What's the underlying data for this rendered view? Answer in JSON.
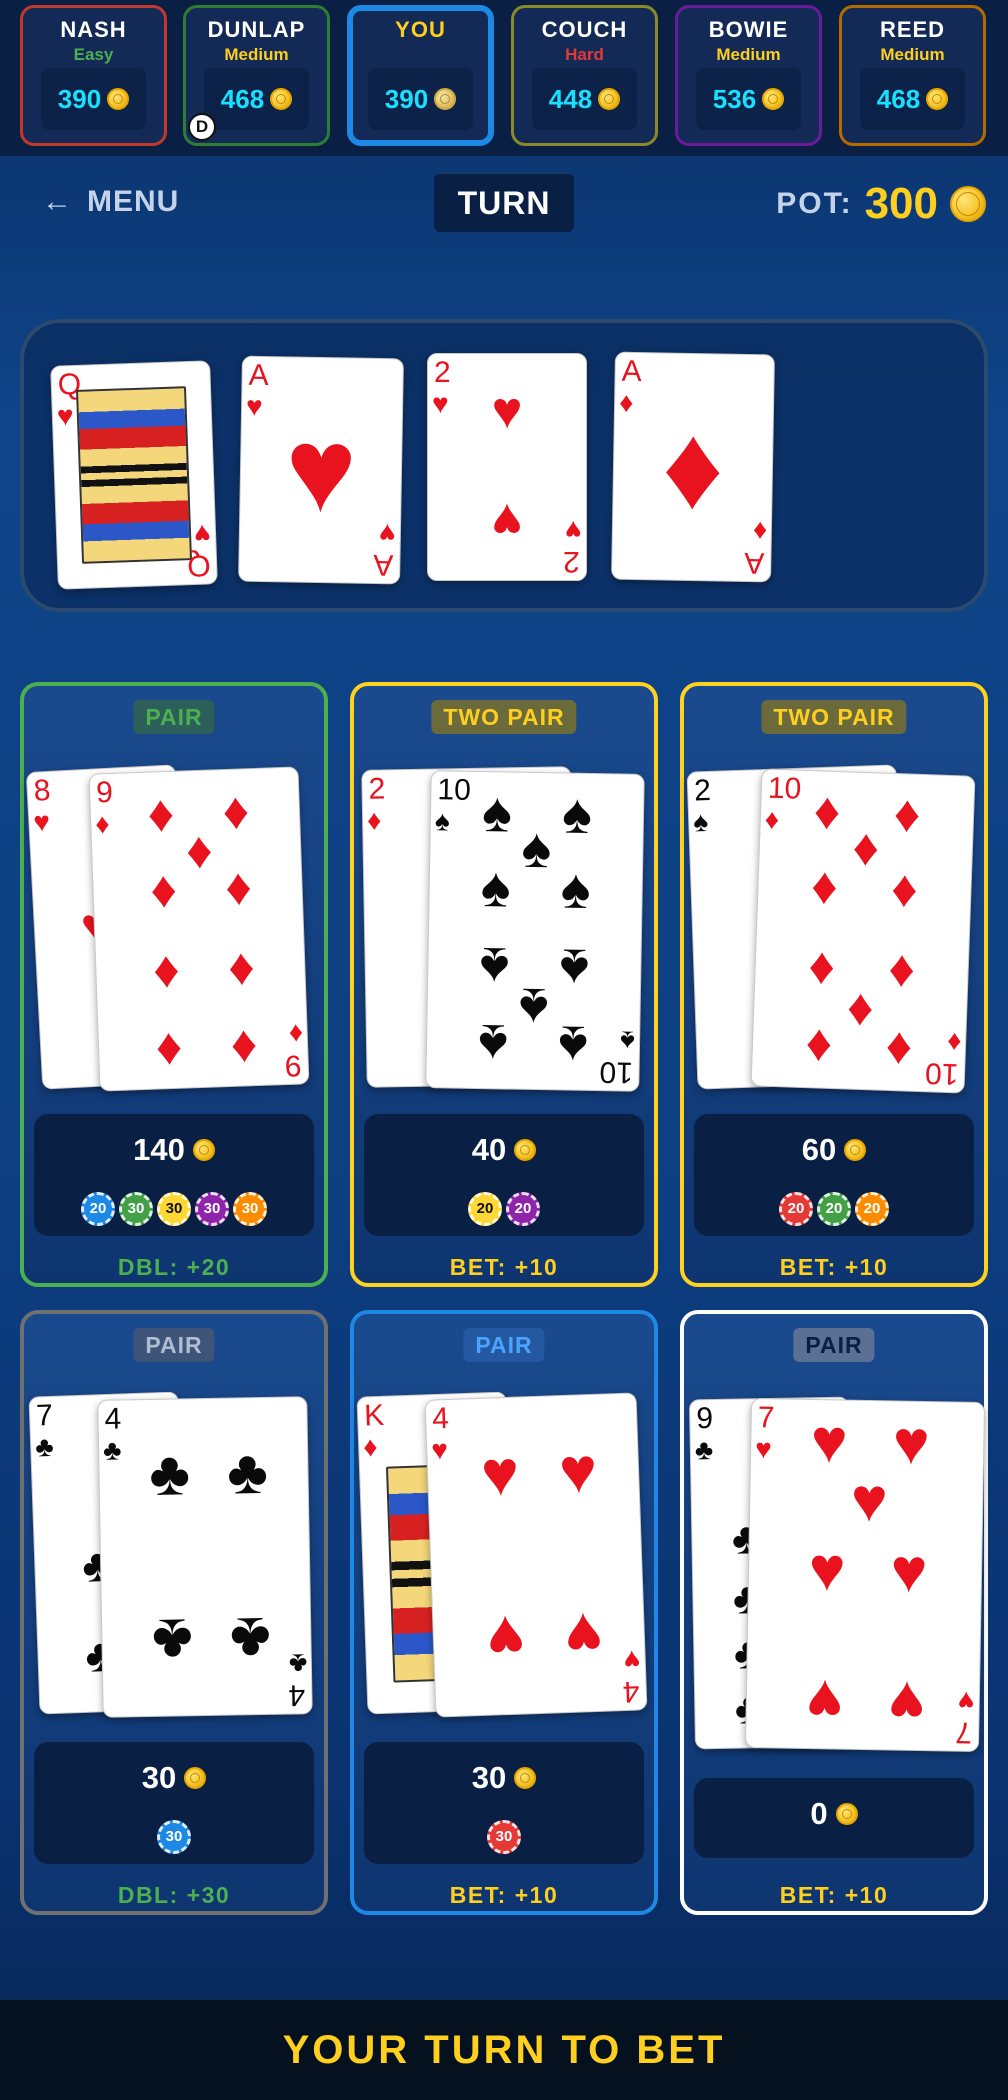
{
  "players": [
    {
      "name": "NASH",
      "difficulty": "Easy",
      "chips": "390",
      "difficulty_color": "#4caf50",
      "border": "#c0392b",
      "is_dealer": false
    },
    {
      "name": "DUNLAP",
      "difficulty": "Medium",
      "chips": "468",
      "difficulty_color": "#ffcf1f",
      "border": "#2e7d32",
      "is_dealer": true
    },
    {
      "name": "YOU",
      "difficulty": "",
      "chips": "390",
      "difficulty_color": "#ffcf1f",
      "border": "#1e88e5",
      "is_dealer": false
    },
    {
      "name": "COUCH",
      "difficulty": "Hard",
      "chips": "448",
      "difficulty_color": "#e53935",
      "border": "#8a8a2a",
      "is_dealer": false
    },
    {
      "name": "BOWIE",
      "difficulty": "Medium",
      "chips": "536",
      "difficulty_color": "#ffcf1f",
      "border": "#6a1b9a",
      "is_dealer": false
    },
    {
      "name": "REED",
      "difficulty": "Medium",
      "chips": "468",
      "difficulty_color": "#ffcf1f",
      "border": "#b36b00",
      "is_dealer": false
    }
  ],
  "dealer_marker": "D",
  "header": {
    "menu_label": "MENU",
    "round": "TURN",
    "pot_label": "POT:",
    "pot_value": "300"
  },
  "board_cards": [
    {
      "rank": "Q",
      "suit": "♥"
    },
    {
      "rank": "A",
      "suit": "♥"
    },
    {
      "rank": "2",
      "suit": "♥"
    },
    {
      "rank": "A",
      "suit": "♦"
    }
  ],
  "hands": [
    {
      "badge": "PAIR",
      "amount": "140",
      "action": "DBL: +20",
      "cards": [
        {
          "rank": "8",
          "suit": "♥"
        },
        {
          "rank": "9",
          "suit": "♦"
        }
      ],
      "chips": [
        {
          "v": "20",
          "c": "#1e88e5"
        },
        {
          "v": "30",
          "c": "#43a047"
        },
        {
          "v": "30",
          "c": "#fdd835"
        },
        {
          "v": "30",
          "c": "#8e24aa"
        },
        {
          "v": "30",
          "c": "#fb8c00"
        }
      ]
    },
    {
      "badge": "TWO PAIR",
      "amount": "40",
      "action": "BET: +10",
      "cards": [
        {
          "rank": "2",
          "suit": "♦"
        },
        {
          "rank": "10",
          "suit": "♠"
        }
      ],
      "chips": [
        {
          "v": "20",
          "c": "#fdd835"
        },
        {
          "v": "20",
          "c": "#8e24aa"
        }
      ]
    },
    {
      "badge": "TWO PAIR",
      "amount": "60",
      "action": "BET: +10",
      "cards": [
        {
          "rank": "2",
          "suit": "♠"
        },
        {
          "rank": "10",
          "suit": "♦"
        }
      ],
      "chips": [
        {
          "v": "20",
          "c": "#e53935"
        },
        {
          "v": "20",
          "c": "#43a047"
        },
        {
          "v": "20",
          "c": "#fb8c00"
        }
      ]
    },
    {
      "badge": "PAIR",
      "amount": "30",
      "action": "DBL: +30",
      "cards": [
        {
          "rank": "7",
          "suit": "♣"
        },
        {
          "rank": "4",
          "suit": "♣"
        }
      ],
      "chips": [
        {
          "v": "30",
          "c": "#1e88e5"
        }
      ]
    },
    {
      "badge": "PAIR",
      "amount": "30",
      "action": "BET: +10",
      "cards": [
        {
          "rank": "K",
          "suit": "♦"
        },
        {
          "rank": "4",
          "suit": "♥"
        }
      ],
      "chips": [
        {
          "v": "30",
          "c": "#e53935"
        }
      ]
    },
    {
      "badge": "PAIR",
      "amount": "0",
      "action": "BET: +10",
      "cards": [
        {
          "rank": "9",
          "suit": "♣"
        },
        {
          "rank": "7",
          "suit": "♥"
        }
      ],
      "chips": []
    }
  ],
  "status_message": "YOUR TURN TO BET"
}
